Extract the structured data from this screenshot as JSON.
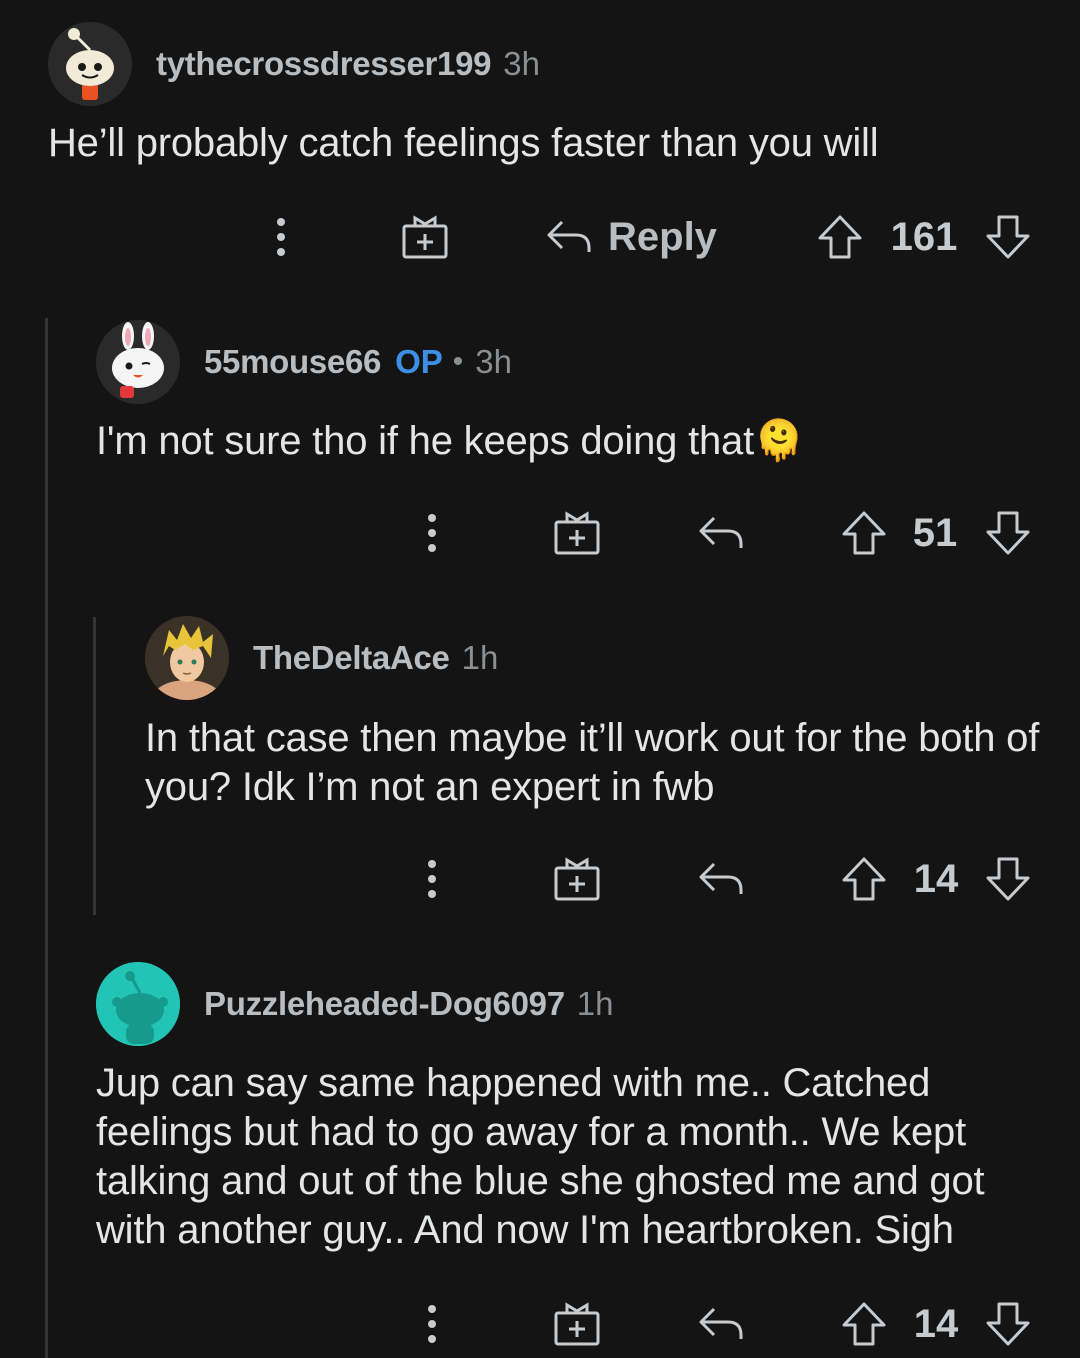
{
  "comments": [
    {
      "username": "tythecrossdresser199",
      "time": "3h",
      "body": "He’ll probably catch feelings faster than you will",
      "reply_label": "Reply",
      "score": "161",
      "avatar_icon": "snoo-avatar-icon"
    },
    {
      "username": "55mouse66",
      "op_badge": "OP",
      "separator": "•",
      "time": "3h",
      "body": "I'm not sure tho if he keeps doing that🫠",
      "score": "51",
      "avatar_icon": "bunny-snoo-avatar-icon"
    },
    {
      "username": "TheDeltaAce",
      "time": "1h",
      "body": "In that case then maybe it’ll work out for the both of you? Idk I’m not an expert in fwb",
      "score": "14",
      "avatar_icon": "anime-character-avatar-icon"
    },
    {
      "username": "Puzzleheaded-Dog6097",
      "time": "1h",
      "body": "Jup can say same happened with me.. Catched feelings but had to go away for a month.. We kept talking and out of the blue she ghosted me and got with another guy.. And now I'm heartbroken. Sigh",
      "score": "14",
      "avatar_icon": "teal-snoo-avatar-icon"
    }
  ],
  "colors": {
    "background": "#141414",
    "op_badge": "#3d8fe6",
    "thread_line": "#343536",
    "teal_avatar": "#22c5b5"
  }
}
